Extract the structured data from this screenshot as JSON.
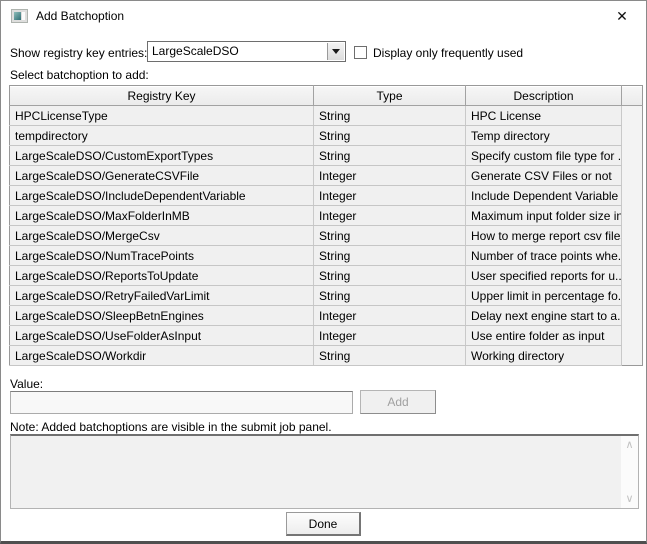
{
  "window": {
    "title": "Add Batchoption"
  },
  "icons": {
    "close_glyph": "✕",
    "scroll_up_glyph": "∧",
    "scroll_down_glyph": "∨"
  },
  "controls": {
    "registry_label": "Show registry key entries:",
    "registry_selected_value": "LargeScaleDSO",
    "frequently_used_checkbox_label": "Display only frequently used",
    "frequently_used_checked": false,
    "select_batchoption_label": "Select batchoption to add:",
    "value_label": "Value:",
    "add_button_label": "Add",
    "add_button_enabled": false,
    "note_text": "Note: Added batchoptions are visible in the submit job panel.",
    "done_button_label": "Done"
  },
  "value_input": {
    "value": "",
    "placeholder": ""
  },
  "message_box": {
    "text": ""
  },
  "table": {
    "headers": [
      "Registry Key",
      "Type",
      "Description"
    ],
    "rows": [
      [
        "HPCLicenseType",
        "String",
        "HPC License"
      ],
      [
        "tempdirectory",
        "String",
        "Temp directory"
      ],
      [
        "LargeScaleDSO/CustomExportTypes",
        "String",
        "Specify custom file type for ..."
      ],
      [
        "LargeScaleDSO/GenerateCSVFile",
        "Integer",
        "Generate CSV Files or not"
      ],
      [
        "LargeScaleDSO/IncludeDependentVariable",
        "Integer",
        "Include Dependent Variable ..."
      ],
      [
        "LargeScaleDSO/MaxFolderInMB",
        "Integer",
        "Maximum input folder size in..."
      ],
      [
        "LargeScaleDSO/MergeCsv",
        "String",
        "How to merge report csv files"
      ],
      [
        "LargeScaleDSO/NumTracePoints",
        "String",
        "Number of trace points whe..."
      ],
      [
        "LargeScaleDSO/ReportsToUpdate",
        "String",
        "User specified reports for u..."
      ],
      [
        "LargeScaleDSO/RetryFailedVarLimit",
        "String",
        "Upper limit in percentage fo..."
      ],
      [
        "LargeScaleDSO/SleepBetnEngines",
        "Integer",
        "Delay next engine start to a..."
      ],
      [
        "LargeScaleDSO/UseFolderAsInput",
        "Integer",
        "Use entire folder as input"
      ],
      [
        "LargeScaleDSO/Workdir",
        "String",
        "Working directory"
      ]
    ]
  },
  "colors": {
    "row_background": "#f0f0f0",
    "disabled_text": "#a0a0a0",
    "icon_teal": "#2f6e74"
  }
}
